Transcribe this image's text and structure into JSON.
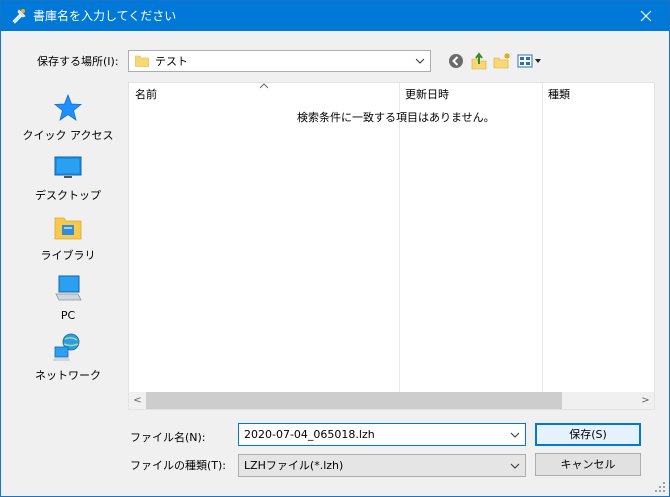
{
  "window": {
    "title": "書庫名を入力してください",
    "close_label": "✕"
  },
  "location": {
    "label": "保存する場所(I):",
    "current": "テスト"
  },
  "places": [
    {
      "id": "quick-access",
      "label": "クイック アクセス",
      "icon": "star-icon"
    },
    {
      "id": "desktop",
      "label": "デスクトップ",
      "icon": "desktop-icon"
    },
    {
      "id": "libraries",
      "label": "ライブラリ",
      "icon": "library-icon"
    },
    {
      "id": "pc",
      "label": "PC",
      "icon": "pc-icon"
    },
    {
      "id": "network",
      "label": "ネットワーク",
      "icon": "network-icon"
    }
  ],
  "file_list": {
    "columns": [
      "名前",
      "更新日時",
      "種類"
    ],
    "empty_message": "検索条件に一致する項目はありません。"
  },
  "file_name": {
    "label": "ファイル名(N):",
    "value": "2020-07-04_065018.lzh"
  },
  "file_type": {
    "label": "ファイルの種類(T):",
    "value": "LZHファイル(*.lzh)"
  },
  "buttons": {
    "save": "保存(S)",
    "cancel": "キャンセル"
  },
  "scrollbar": {
    "left_arrow": "<",
    "right_arrow": ">"
  },
  "colors": {
    "accent": "#0078d7",
    "dialog_bg": "#f0f0f0"
  }
}
